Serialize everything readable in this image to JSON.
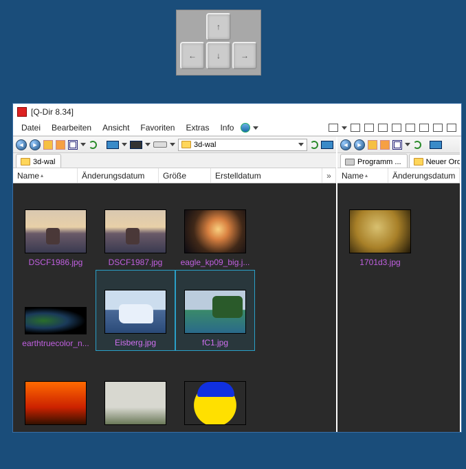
{
  "window": {
    "title": "[Q-Dir 8.34]"
  },
  "menu": {
    "items": [
      "Datei",
      "Bearbeiten",
      "Ansicht",
      "Favoriten",
      "Extras",
      "Info"
    ]
  },
  "leftPane": {
    "addressFolder": "3d-wal",
    "tabs": [
      {
        "label": "3d-wal"
      }
    ],
    "columns": {
      "name": "Name",
      "modified": "Änderungsdatum",
      "size": "Größe",
      "created": "Erstelldatum"
    },
    "files": [
      {
        "name": "DSCF1986.jpg",
        "img": "img-sunset1"
      },
      {
        "name": "DSCF1987.jpg",
        "img": "img-sunset1"
      },
      {
        "name": "eagle_kp09_big.j...",
        "img": "img-nebula"
      },
      {
        "name": "earthtruecolor_n...",
        "img": "img-earth"
      },
      {
        "name": "Eisberg.jpg",
        "img": "img-iceberg",
        "selected": true
      },
      {
        "name": "fC1.jpg",
        "img": "img-island",
        "selected": true
      },
      {
        "name": "",
        "img": "img-fire"
      },
      {
        "name": "",
        "img": "img-castle"
      },
      {
        "name": "",
        "img": "img-smiley"
      }
    ]
  },
  "rightPane": {
    "tabs": [
      {
        "label": "Programm ...",
        "type": "drive"
      },
      {
        "label": "Neuer Ord ...",
        "type": "folder"
      }
    ],
    "columns": {
      "name": "Name",
      "modified": "Änderungsdatum"
    },
    "files": [
      {
        "name": "1701d3.jpg",
        "img": "img-globe2"
      }
    ]
  }
}
